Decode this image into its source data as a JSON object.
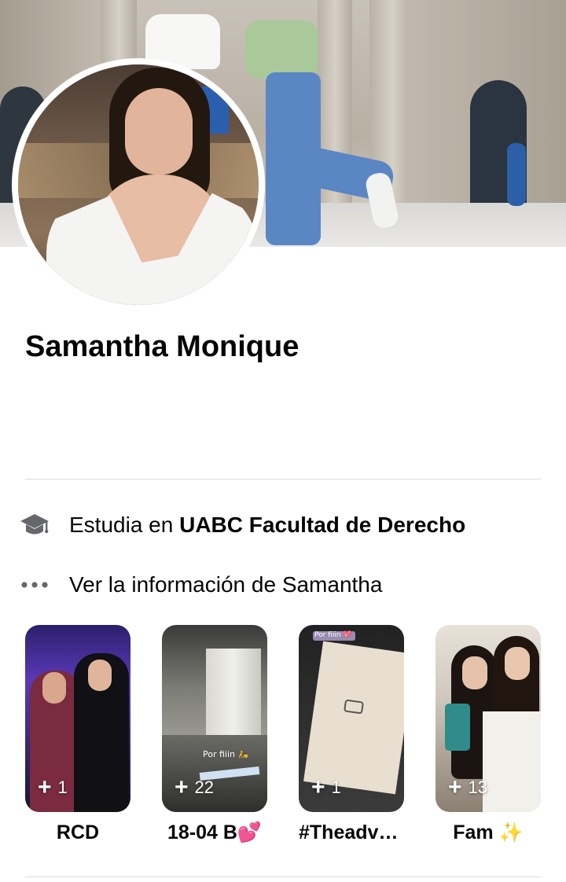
{
  "profile": {
    "name": "Samantha Monique"
  },
  "intro": {
    "study_prefix": "Estudia en ",
    "study_place": "UABC Facultad de Derecho",
    "more_info": "Ver la información de Samantha"
  },
  "highlights": [
    {
      "label": "RCD",
      "count": "1"
    },
    {
      "label": "18-04 B💕",
      "count": "22"
    },
    {
      "label": "#Theadve...",
      "count": "1"
    },
    {
      "label": "Fam ✨",
      "count": "13"
    }
  ],
  "thumb_texts": {
    "hl2_caption": "Por fiiin 🛵",
    "hl3_badge": "Por fiiin 💖"
  },
  "icons": {
    "study": "graduation-cap-icon",
    "more": "more-dots-icon",
    "add": "plus-icon"
  }
}
